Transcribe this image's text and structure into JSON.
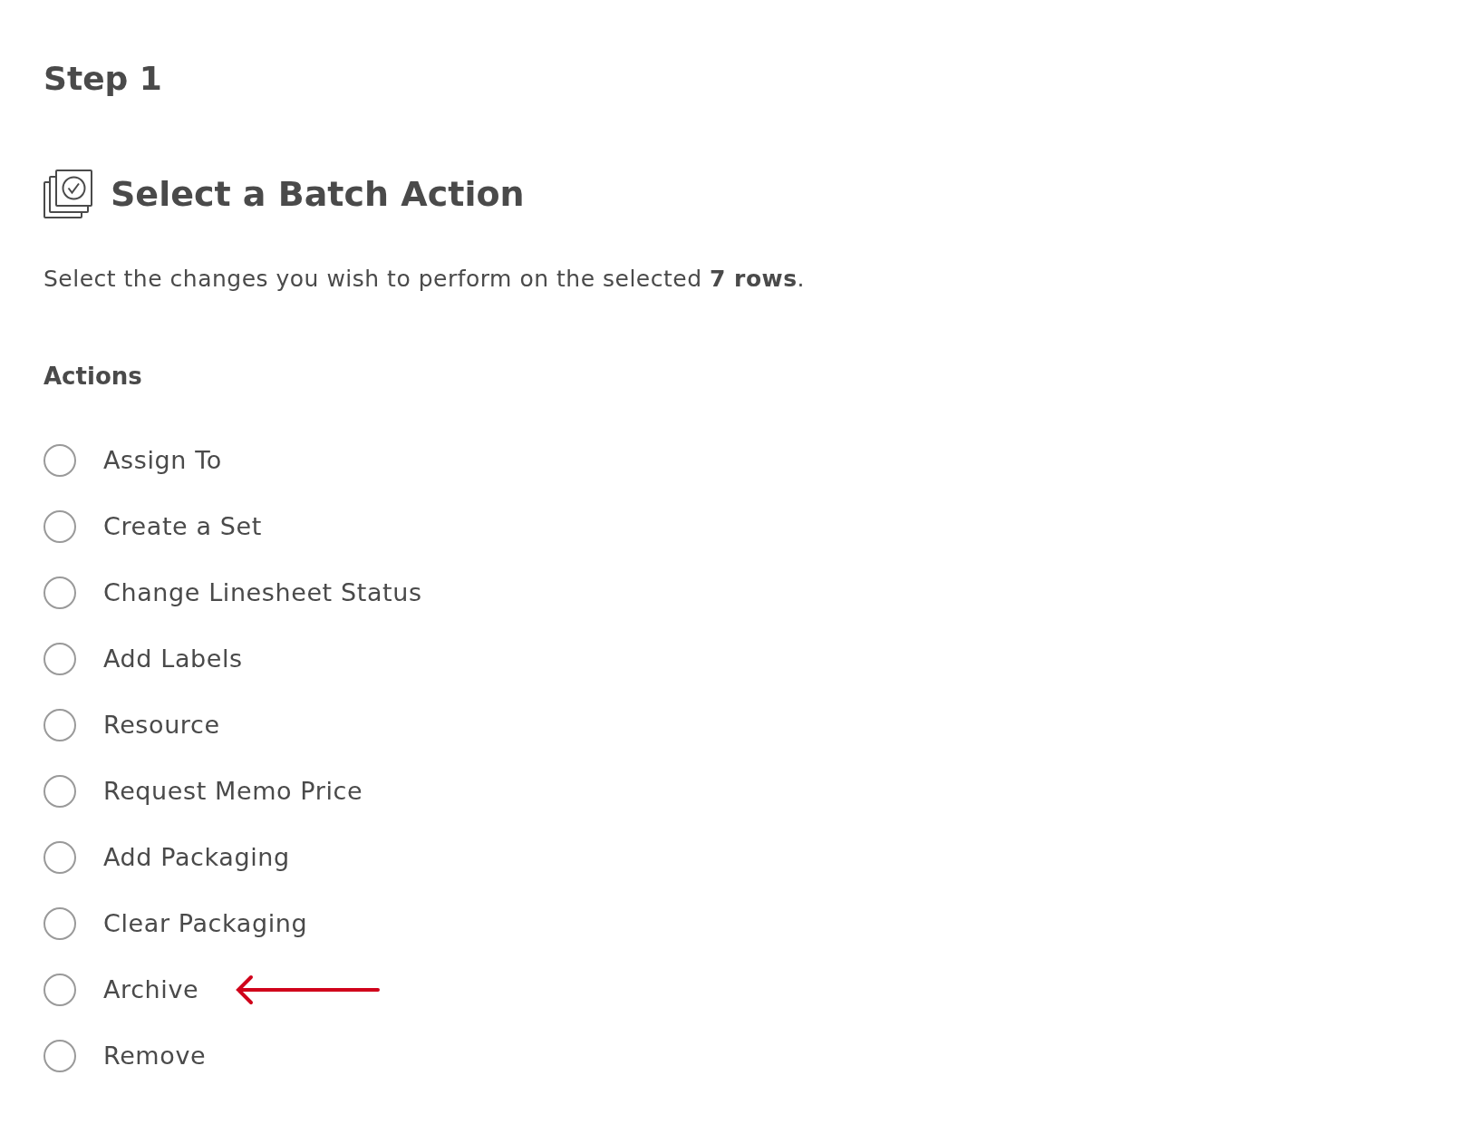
{
  "step": "Step 1",
  "heading": "Select a Batch Action",
  "description": "Select the changes you wish to perform on the selected **7 rows**.",
  "actions_label": "Actions",
  "actions": [
    {
      "label": "Assign To",
      "selected": false,
      "arrow": false
    },
    {
      "label": "Create a Set",
      "selected": false,
      "arrow": false
    },
    {
      "label": "Change Linesheet Status",
      "selected": false,
      "arrow": false
    },
    {
      "label": "Add Labels",
      "selected": false,
      "arrow": false
    },
    {
      "label": "Resource",
      "selected": false,
      "arrow": false
    },
    {
      "label": "Request Memo Price",
      "selected": false,
      "arrow": false
    },
    {
      "label": "Add Packaging",
      "selected": false,
      "arrow": false
    },
    {
      "label": "Clear Packaging",
      "selected": false,
      "arrow": false
    },
    {
      "label": "Archive",
      "selected": false,
      "arrow": true
    },
    {
      "label": "Remove",
      "selected": false,
      "arrow": false
    }
  ]
}
